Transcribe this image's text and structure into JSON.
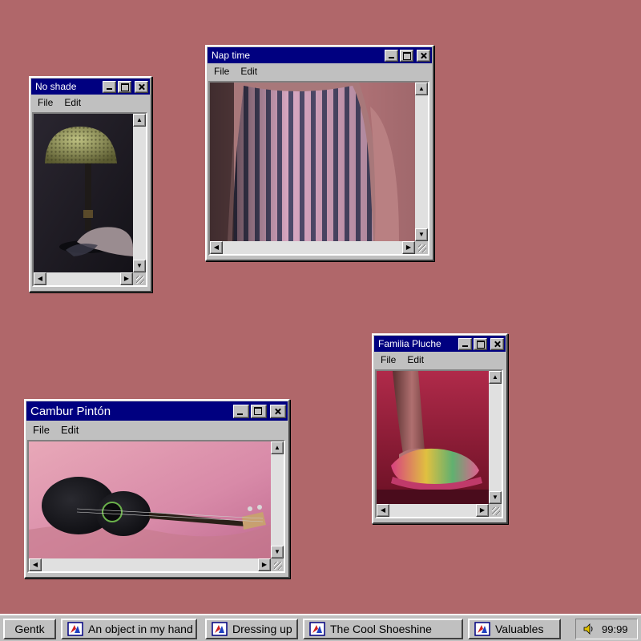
{
  "desktop": {
    "background": "#b0676a"
  },
  "windows": [
    {
      "title": "No shade",
      "menu": {
        "file": "File",
        "edit": "Edit"
      }
    },
    {
      "title": "Nap time",
      "menu": {
        "file": "File",
        "edit": "Edit"
      }
    },
    {
      "title": "Familia Pluche",
      "menu": {
        "file": "File",
        "edit": "Edit"
      }
    },
    {
      "title": "Cambur Pintón",
      "menu": {
        "file": "File",
        "edit": "Edit"
      }
    }
  ],
  "taskbar": {
    "start_label": "Gentk",
    "buttons": [
      {
        "label": "An object in my hand",
        "icon": "app-icon"
      },
      {
        "label": "Dressing up",
        "icon": "app-icon"
      },
      {
        "label": "The Cool Shoeshine",
        "icon": "app-icon"
      },
      {
        "label": "Valuables",
        "icon": "app-icon"
      }
    ],
    "tray": {
      "icon": "speaker-icon",
      "clock": "99:99"
    }
  },
  "colors": {
    "titlebar": "#000080",
    "chrome": "#c0c0c0"
  }
}
